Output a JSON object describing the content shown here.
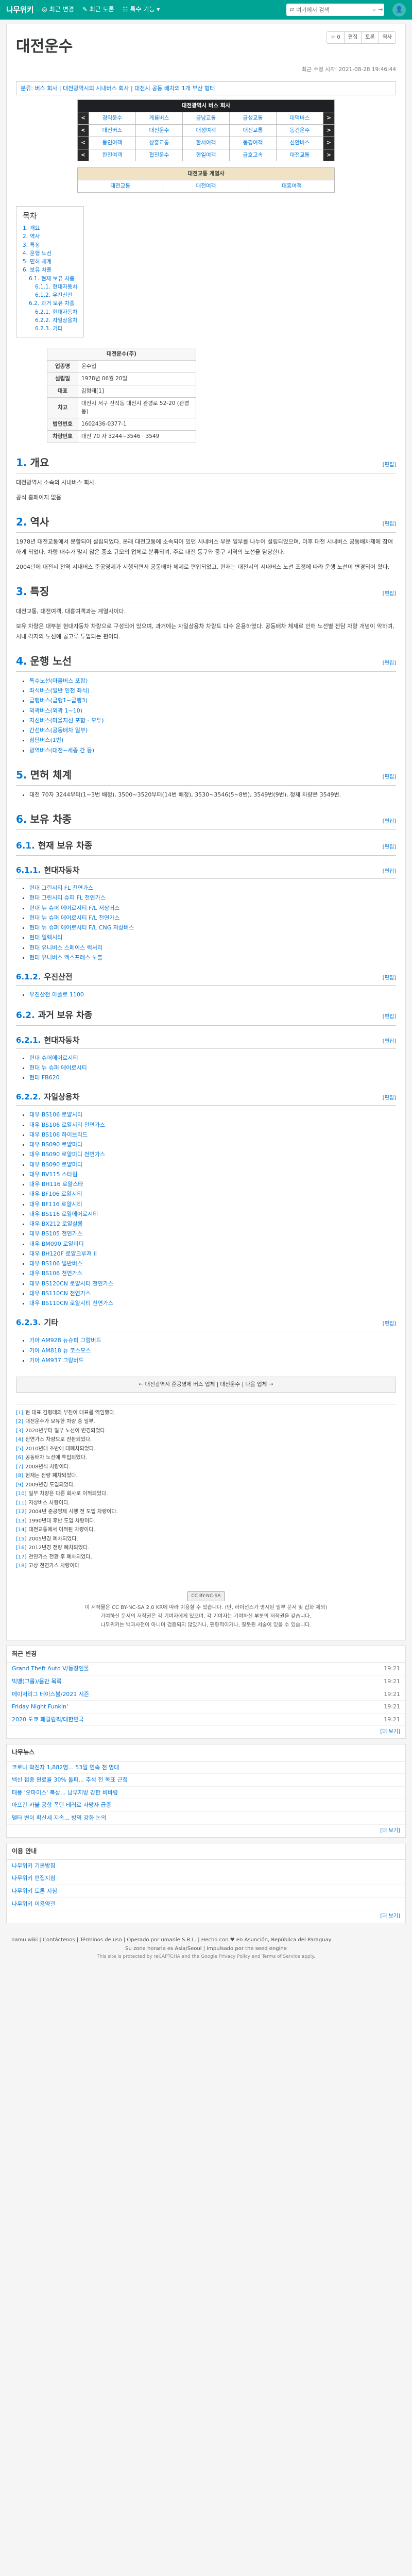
{
  "topbar": {
    "logo": "나무위키",
    "nav": [
      {
        "icon": "◎",
        "label": "최근 변경"
      },
      {
        "icon": "✎",
        "label": "최근 토론"
      },
      {
        "icon": "☷",
        "label": "특수 기능 ▾"
      }
    ],
    "search_placeholder": "여기에서 검색",
    "accent": "#00a495"
  },
  "article": {
    "title": "대전운수",
    "tools": [
      "☆ 0",
      "편집",
      "토론",
      "역사"
    ],
    "last_modified": "최근 수정 시각: 2021-08-28 19:46:44",
    "category": "분류: 버스 회사 | 대전광역시의 시내버스 회사 | 대전시 공동 배차의 1개 부산 형태"
  },
  "navbox": {
    "title": "대전광역시 버스 회사",
    "rows": [
      [
        "경익운수",
        "계룡버스",
        "금남교통",
        "금성교통",
        "대덕버스"
      ],
      [
        "대전버스",
        "대전운수",
        "대성여객",
        "대전교통",
        "동건운수"
      ],
      [
        "동인여객",
        "삼흥교통",
        "한서여객",
        "동경여객",
        "신안버스"
      ],
      [
        "한진여객",
        "협진운수",
        "한일여객",
        "금호고속",
        "대전교통"
      ]
    ]
  },
  "subnav": {
    "head": "대전교통 계열사",
    "items": [
      "대전교통",
      "대전여객",
      "대흥여객"
    ]
  },
  "toc": {
    "title": "목차",
    "items": [
      {
        "num": "1.",
        "label": "개요",
        "level": 0
      },
      {
        "num": "2.",
        "label": "역사",
        "level": 0
      },
      {
        "num": "3.",
        "label": "특징",
        "level": 0
      },
      {
        "num": "4.",
        "label": "운행 노선",
        "level": 0
      },
      {
        "num": "5.",
        "label": "면허 체계",
        "level": 0
      },
      {
        "num": "6.",
        "label": "보유 차종",
        "level": 0
      },
      {
        "num": "6.1.",
        "label": "현재 보유 차종",
        "level": 1
      },
      {
        "num": "6.1.1.",
        "label": "현대자동차",
        "level": 2
      },
      {
        "num": "6.1.2.",
        "label": "우진산전",
        "level": 2
      },
      {
        "num": "6.2.",
        "label": "과거 보유 차종",
        "level": 1
      },
      {
        "num": "6.2.1.",
        "label": "현대자동차",
        "level": 2
      },
      {
        "num": "6.2.2.",
        "label": "자일상용차",
        "level": 2
      },
      {
        "num": "6.2.3.",
        "label": "기타",
        "level": 2
      }
    ]
  },
  "infobox": {
    "title": "대전운수(주)",
    "rows": [
      {
        "k": "업종명",
        "v": "운수업"
      },
      {
        "k": "설립일",
        "v": "1978년 06월 20일"
      },
      {
        "k": "대표",
        "v": "김형태[1]"
      },
      {
        "k": "차고",
        "v": "대전시 서구 산직동 대전시 관평로 52-20 (관평동)"
      },
      {
        "k": "법인번호",
        "v": "1602436-0377-1"
      },
      {
        "k": "차량번호",
        "v": "대전 70 자 3244~3546 · 3549"
      }
    ]
  },
  "sections": {
    "s1": {
      "num": "1.",
      "title": "개요",
      "edit": "[편집]"
    },
    "s1_text": "대전광역시 소속의 시내버스 회사.",
    "s1_web": "공식 홈페이지 없음",
    "s2": {
      "num": "2.",
      "title": "역사",
      "edit": "[편집]"
    },
    "s2_text1": "1978년 대전교통에서 분할되어 설립되었다. 본래 대전교통에 소속되어 있던 시내버스 부문 일부를 나누어 설립되었으며, 이후 대전 시내버스 공동배차제에 참여하게 되었다. 차량 대수가 많지 않은 중소 규모의 업체로 분류되며, 주로 대전 동구와 중구 지역의 노선을 담당한다.",
    "s2_text2": "2004년에 대전시 전역 시내버스 준공영제가 시행되면서 공동배차 체제로 편입되었고, 현재는 대전시의 시내버스 노선 조정에 따라 운행 노선이 변경되어 왔다.",
    "s3": {
      "num": "3.",
      "title": "특징",
      "edit": "[편집]"
    },
    "s3_text1": "대전교통, 대전여객, 대흥여객과는 계열사이다.",
    "s3_text2": "보유 차량은 대부분 현대자동차 차량으로 구성되어 있으며, 과거에는 자일상용차 차량도 다수 운용하였다. 공동배차 체제로 인해 노선별 전담 차량 개념이 약하며, 시내 각지의 노선에 골고루 투입되는 편이다.",
    "s4": {
      "num": "4.",
      "title": "운행 노선",
      "edit": "[편집]"
    },
    "routes": [
      "특수노선(마을버스 포함)",
      "좌석버스(일반 인천 좌석)",
      "급행버스(급행1~급행3)",
      "외곽버스(외곽 1~10)",
      "지선버스(마을지선 포함 - 모두)",
      "간선버스(공동배차 일부)",
      "첨단버스(1번)",
      "광역버스(대전~세종 간 등)"
    ],
    "s5": {
      "num": "5.",
      "title": "면허 체계",
      "edit": "[편집]"
    },
    "s5_text": "대전 70자 3244부터(1~3번 배정), 3500~3520부터(14번 배정), 3530~3546(5~8번), 3549번(9번), 정체 차량은 3549번.",
    "s6": {
      "num": "6.",
      "title": "보유 차종",
      "edit": "[편집]"
    },
    "s61": {
      "num": "6.1.",
      "title": "현재 보유 차종",
      "edit": "[편집]"
    },
    "s611": {
      "num": "6.1.1.",
      "title": "현대자동차",
      "edit": "[편집]"
    },
    "current_hyundai": [
      "현대 그린시티 FL 천연가스",
      "현대 그린시티 슈퍼 FL 천연가스",
      "현대 뉴 슈퍼 에어로시티 F/L 저상버스",
      "현대 뉴 슈퍼 에어로시티 F/L 천연가스",
      "현대 뉴 슈퍼 에어로시티 F/L CNG 저상버스",
      "현대 일렉시티",
      "현대 유니버스 스페이스 럭셔리",
      "현대 유니버스 엑스프레스 노블"
    ],
    "s612": {
      "num": "6.1.2.",
      "title": "우진산전",
      "edit": "[편집]"
    },
    "current_woojin": [
      "우진산전 아폴로 1100"
    ],
    "s62": {
      "num": "6.2.",
      "title": "과거 보유 차종",
      "edit": "[편집]"
    },
    "s621": {
      "num": "6.2.1.",
      "title": "현대자동차",
      "edit": "[편집]"
    },
    "past_hyundai": [
      "현대 슈퍼에어로시티",
      "현대 뉴 슈퍼 에어로시티",
      "현대 FB620"
    ],
    "s622": {
      "num": "6.2.2.",
      "title": "자일상용차",
      "edit": "[편집]"
    },
    "past_seil": [
      "대우 BS106 로얄시티",
      "대우 BS106 로얄시티 천연가스",
      "대우 BS106 하이브리드",
      "대우 BS090 로얄미디",
      "대우 BS090 로얄미디 천연가스",
      "대우 BS090 로얄미디",
      "대우 BV115 스타림",
      "대우 BH116 로얄스타",
      "대우 BF106 로얄시티",
      "대우 BF116 로얄시티",
      "대우 BS116 로얄에어로시티",
      "대우 BX212 로얄살롱",
      "대우 BS105 천연가스",
      "대우 BM090 로얄미디",
      "대우 BH120F 로얄크루져 II",
      "대우 BS106 일반버스",
      "대우 BS106 천연가스",
      "대우 BS120CN 로얄시티 천연가스",
      "대우 BS110CN 천연가스",
      "대우 BS110CN 로얄시티 천연가스"
    ],
    "s623": {
      "num": "6.2.3.",
      "title": "기타",
      "edit": "[편집]"
    },
    "past_other": [
      "기아 AM928 뉴슈퍼 그랑버드",
      "기아 AM818 뉴 코스모스",
      "기아 AM937 그랑버드"
    ]
  },
  "footer_nav": "← 대전광역시 준공영제 버스 업체 | 대전운수 | 다음 업체 →",
  "notes": [
    "현 대표 김형태의 부친이 대표를 역임했다.",
    "대전운수가 보유한 차량 중 일부.",
    "2020년부터 일부 노선이 변경되었다.",
    "천연가스 차량으로 전환되었다.",
    "2010년대 초반에 대폐차되었다.",
    "공동배차 노선에 투입되었다.",
    "2008년식 차량이다.",
    "현재는 전량 폐차되었다.",
    "2009년경 도입되었다.",
    "일부 차량은 다른 회사로 이적되었다.",
    "저상버스 차량이다.",
    "2004년 준공영제 시행 전 도입 차량이다.",
    "1990년대 후반 도입 차량이다.",
    "대전교통에서 이적된 차량이다.",
    "2005년경 폐차되었다.",
    "2012년경 전량 폐차되었다.",
    "천연가스 전환 후 폐차되었다.",
    "고상 천연가스 차량이다."
  ],
  "license": {
    "badge": "CC BY-NC-SA",
    "line1": "이 저작물은 CC BY-NC-SA 2.0 KR에 따라 이용할 수 있습니다. (단, 라이선스가 명시된 일부 문서 및 삽화 제외)",
    "line2": "기여하신 문서의 저작권은 각 기여자에게 있으며, 각 기여자는 기여하신 부분의 저작권을 갖습니다.",
    "line3": "나무위키는 백과사전이 아니며 검증되지 않았거나, 편향적이거나, 잘못된 서술이 있을 수 있습니다."
  },
  "recent": {
    "title": "최근 변경",
    "more": "[더 보기]",
    "items": [
      {
        "label": "Grand Theft Auto V/등장인물",
        "time": "19:21"
      },
      {
        "label": "빅뱅(그룹)/음반 목록",
        "time": "19:21"
      },
      {
        "label": "메이저리그 베이스볼/2021 시즌",
        "time": "19:21"
      },
      {
        "label": "Friday Night Funkin'",
        "time": "19:21"
      },
      {
        "label": "2020 도쿄 패럴림픽/대한민국",
        "time": "19:21"
      }
    ]
  },
  "news": {
    "title": "나무뉴스",
    "more": "[더 보기]",
    "items": [
      "코로나 확진자 1,882명... 53일 연속 천 명대",
      "백신 접종 완료율 30% 돌파... 추석 전 목표 근접",
      "태풍 '오마이스' 북상... 남부지방 강한 비바람",
      "아프간 카불 공항 폭탄 테러로 사망자 급증",
      "델타 변이 확산세 지속... 방역 강화 논의"
    ]
  },
  "docs": {
    "title": "이용 안내",
    "more": "[더 보기]",
    "items": [
      "나무위키 기본방침",
      "나무위키 편집지침",
      "나무위키 토론 지침",
      "나무위키 이용약관"
    ]
  },
  "footer": {
    "links": "namu wiki | Contáctenos | Términos de uso | Operado por umanle S.R.L. | Hecho con ♥ en Asunción, República del Paraguay",
    "line2": "Su zona horaria es Asia/Seoul | Impulsado por the seed engine",
    "line3": "This site is protected by reCAPTCHA and the Google Privacy Policy and Terms of Service apply."
  }
}
